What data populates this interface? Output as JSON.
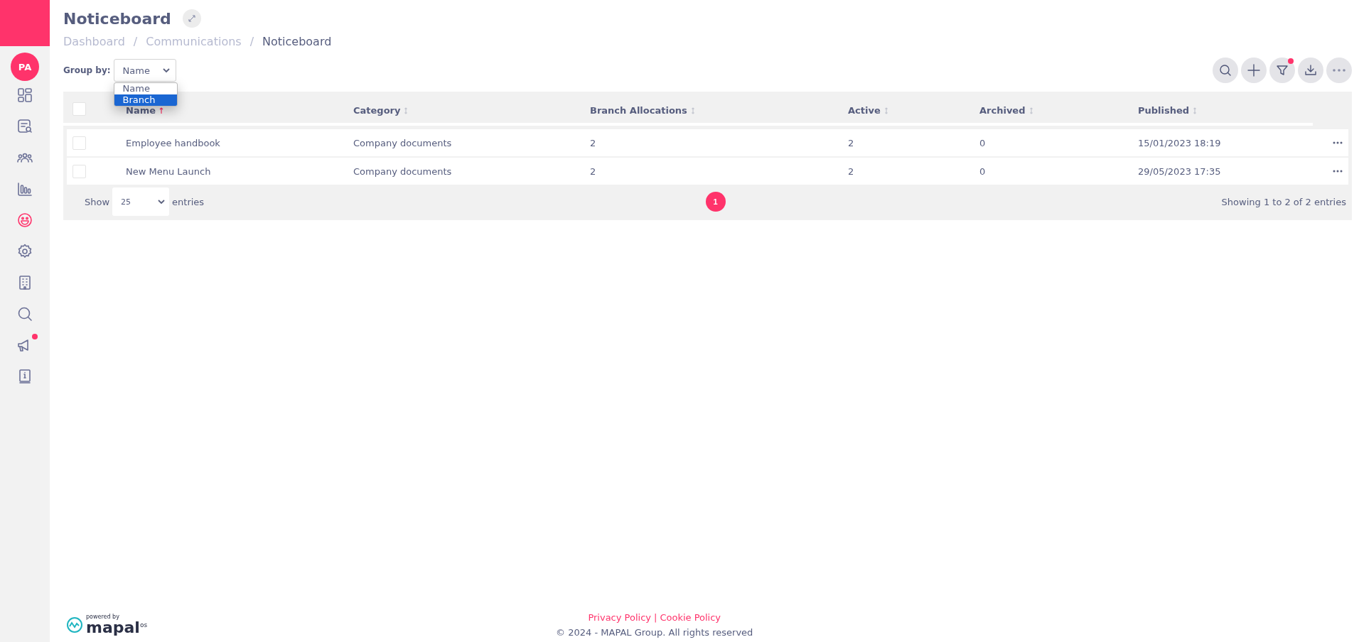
{
  "sidebar": {
    "avatar": "PA",
    "items": [
      {
        "selected": false,
        "notification": false
      },
      {
        "selected": false,
        "notification": false
      },
      {
        "selected": false,
        "notification": false
      },
      {
        "selected": false,
        "notification": false
      },
      {
        "selected": true,
        "notification": false
      },
      {
        "selected": false,
        "notification": false
      },
      {
        "selected": false,
        "notification": false
      },
      {
        "selected": false,
        "notification": false
      },
      {
        "selected": false,
        "notification": true
      },
      {
        "selected": false,
        "notification": false
      }
    ]
  },
  "page": {
    "title": "Noticeboard",
    "breadcrumb": [
      {
        "label": "Dashboard",
        "current": false
      },
      {
        "label": "Communications",
        "current": false
      },
      {
        "label": "Noticeboard",
        "current": true
      }
    ],
    "separator": "/"
  },
  "group_by": {
    "label": "Group by:",
    "value": "Name",
    "expanded": true,
    "options": [
      {
        "label": "Name",
        "highlighted": false
      },
      {
        "label": "Branch",
        "highlighted": true
      }
    ]
  },
  "toolbar": [
    {
      "notification": false
    },
    {
      "notification": false
    },
    {
      "notification": true
    },
    {
      "notification": false
    },
    {
      "notification": false
    }
  ],
  "table": {
    "columns": [
      {
        "label": "Name",
        "sorted": true
      },
      {
        "label": "Category",
        "sorted": false
      },
      {
        "label": "Branch Allocations",
        "sorted": false
      },
      {
        "label": "Active",
        "sorted": false
      },
      {
        "label": "Archived",
        "sorted": false
      },
      {
        "label": "Published",
        "sorted": false
      }
    ],
    "all_checked": false,
    "rows": [
      {
        "checked": false,
        "cells": [
          "Employee handbook",
          "Company documents",
          "2",
          "2",
          "0",
          "15/01/2023 18:19"
        ]
      },
      {
        "checked": false,
        "cells": [
          "New Menu Launch",
          "Company documents",
          "2",
          "2",
          "0",
          "29/05/2023 17:35"
        ]
      }
    ],
    "show_label": "Show",
    "page_size": "25",
    "entries_label": "entries",
    "pages": [
      {
        "label": "1",
        "selected": true
      }
    ],
    "info": "Showing 1 to 2 of 2 entries"
  },
  "footer": {
    "powered_by": "powered by",
    "logo": "mapal",
    "logo_suffix": "os",
    "links": [
      {
        "label": "Privacy Policy"
      },
      {
        "label": "Cookie Policy"
      }
    ],
    "link_separator": "|",
    "copyright": "© 2024 - MAPAL Group. All rights reserved"
  }
}
